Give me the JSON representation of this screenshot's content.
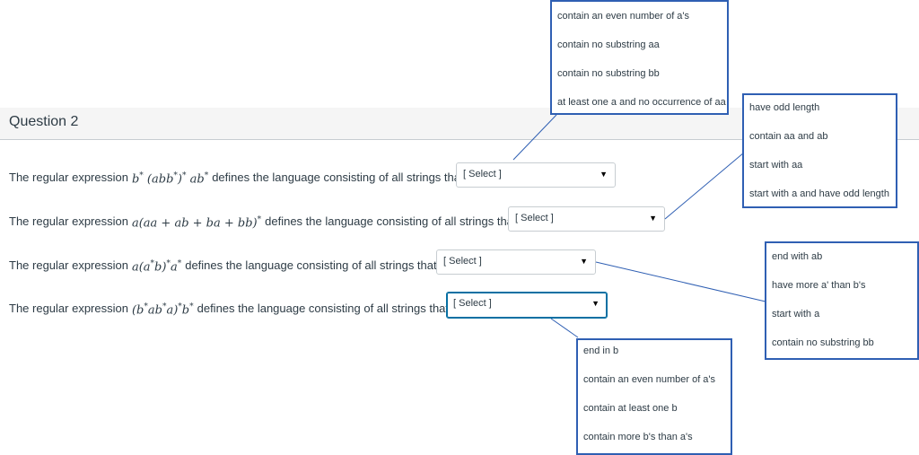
{
  "question": {
    "title": "Question 2"
  },
  "rows": [
    {
      "prefix": "The regular expression",
      "suffix": "defines the language consisting of all strings that",
      "select_label": "[ Select ]"
    },
    {
      "prefix": "The regular expression",
      "suffix": "defines the language consisting of all strings that",
      "select_label": "[ Select ]"
    },
    {
      "prefix": "The regular expression",
      "suffix": "defines the language consisting of all strings that",
      "select_label": "[ Select ]"
    },
    {
      "prefix": "The regular expression",
      "suffix": "defines the language consisting of all strings that",
      "select_label": "[ Select ]"
    }
  ],
  "dropdowns": {
    "d1": [
      "contain an even number of a's",
      "contain no substring aa",
      "contain no substring bb",
      "at least one a and no occurrence of aa"
    ],
    "d2": [
      "have odd length",
      "contain aa and ab",
      "start with aa",
      "start with a and have odd length"
    ],
    "d3": [
      "end with ab",
      "have more a' than b's",
      "start with a",
      "contain no substring bb"
    ],
    "d4": [
      "end in b",
      "contain an even number of a's",
      "contain at least one b",
      "contain more b's than a's"
    ]
  },
  "icons": {
    "arrow": "caret-down-icon"
  },
  "colors": {
    "dropdown_border": "#2f5fb3",
    "connector": "#2f5fb3",
    "focus": "#0770a3"
  }
}
